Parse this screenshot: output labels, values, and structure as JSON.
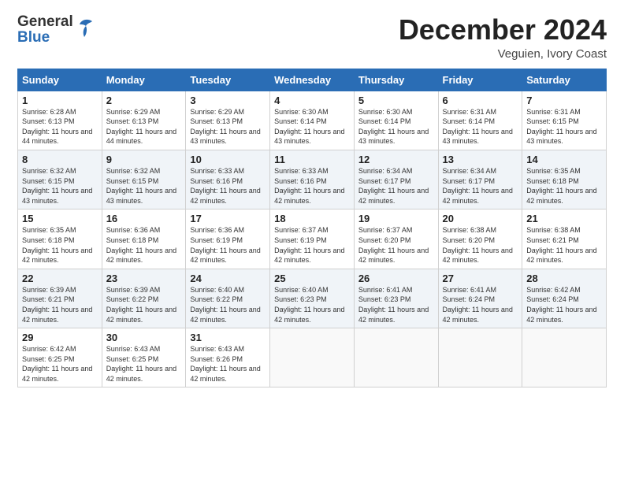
{
  "header": {
    "logo_general": "General",
    "logo_blue": "Blue",
    "month": "December 2024",
    "location": "Veguien, Ivory Coast"
  },
  "days_of_week": [
    "Sunday",
    "Monday",
    "Tuesday",
    "Wednesday",
    "Thursday",
    "Friday",
    "Saturday"
  ],
  "weeks": [
    [
      {
        "day": "1",
        "sunrise": "Sunrise: 6:28 AM",
        "sunset": "Sunset: 6:13 PM",
        "daylight": "Daylight: 11 hours and 44 minutes."
      },
      {
        "day": "2",
        "sunrise": "Sunrise: 6:29 AM",
        "sunset": "Sunset: 6:13 PM",
        "daylight": "Daylight: 11 hours and 44 minutes."
      },
      {
        "day": "3",
        "sunrise": "Sunrise: 6:29 AM",
        "sunset": "Sunset: 6:13 PM",
        "daylight": "Daylight: 11 hours and 43 minutes."
      },
      {
        "day": "4",
        "sunrise": "Sunrise: 6:30 AM",
        "sunset": "Sunset: 6:14 PM",
        "daylight": "Daylight: 11 hours and 43 minutes."
      },
      {
        "day": "5",
        "sunrise": "Sunrise: 6:30 AM",
        "sunset": "Sunset: 6:14 PM",
        "daylight": "Daylight: 11 hours and 43 minutes."
      },
      {
        "day": "6",
        "sunrise": "Sunrise: 6:31 AM",
        "sunset": "Sunset: 6:14 PM",
        "daylight": "Daylight: 11 hours and 43 minutes."
      },
      {
        "day": "7",
        "sunrise": "Sunrise: 6:31 AM",
        "sunset": "Sunset: 6:15 PM",
        "daylight": "Daylight: 11 hours and 43 minutes."
      }
    ],
    [
      {
        "day": "8",
        "sunrise": "Sunrise: 6:32 AM",
        "sunset": "Sunset: 6:15 PM",
        "daylight": "Daylight: 11 hours and 43 minutes."
      },
      {
        "day": "9",
        "sunrise": "Sunrise: 6:32 AM",
        "sunset": "Sunset: 6:15 PM",
        "daylight": "Daylight: 11 hours and 43 minutes."
      },
      {
        "day": "10",
        "sunrise": "Sunrise: 6:33 AM",
        "sunset": "Sunset: 6:16 PM",
        "daylight": "Daylight: 11 hours and 42 minutes."
      },
      {
        "day": "11",
        "sunrise": "Sunrise: 6:33 AM",
        "sunset": "Sunset: 6:16 PM",
        "daylight": "Daylight: 11 hours and 42 minutes."
      },
      {
        "day": "12",
        "sunrise": "Sunrise: 6:34 AM",
        "sunset": "Sunset: 6:17 PM",
        "daylight": "Daylight: 11 hours and 42 minutes."
      },
      {
        "day": "13",
        "sunrise": "Sunrise: 6:34 AM",
        "sunset": "Sunset: 6:17 PM",
        "daylight": "Daylight: 11 hours and 42 minutes."
      },
      {
        "day": "14",
        "sunrise": "Sunrise: 6:35 AM",
        "sunset": "Sunset: 6:18 PM",
        "daylight": "Daylight: 11 hours and 42 minutes."
      }
    ],
    [
      {
        "day": "15",
        "sunrise": "Sunrise: 6:35 AM",
        "sunset": "Sunset: 6:18 PM",
        "daylight": "Daylight: 11 hours and 42 minutes."
      },
      {
        "day": "16",
        "sunrise": "Sunrise: 6:36 AM",
        "sunset": "Sunset: 6:18 PM",
        "daylight": "Daylight: 11 hours and 42 minutes."
      },
      {
        "day": "17",
        "sunrise": "Sunrise: 6:36 AM",
        "sunset": "Sunset: 6:19 PM",
        "daylight": "Daylight: 11 hours and 42 minutes."
      },
      {
        "day": "18",
        "sunrise": "Sunrise: 6:37 AM",
        "sunset": "Sunset: 6:19 PM",
        "daylight": "Daylight: 11 hours and 42 minutes."
      },
      {
        "day": "19",
        "sunrise": "Sunrise: 6:37 AM",
        "sunset": "Sunset: 6:20 PM",
        "daylight": "Daylight: 11 hours and 42 minutes."
      },
      {
        "day": "20",
        "sunrise": "Sunrise: 6:38 AM",
        "sunset": "Sunset: 6:20 PM",
        "daylight": "Daylight: 11 hours and 42 minutes."
      },
      {
        "day": "21",
        "sunrise": "Sunrise: 6:38 AM",
        "sunset": "Sunset: 6:21 PM",
        "daylight": "Daylight: 11 hours and 42 minutes."
      }
    ],
    [
      {
        "day": "22",
        "sunrise": "Sunrise: 6:39 AM",
        "sunset": "Sunset: 6:21 PM",
        "daylight": "Daylight: 11 hours and 42 minutes."
      },
      {
        "day": "23",
        "sunrise": "Sunrise: 6:39 AM",
        "sunset": "Sunset: 6:22 PM",
        "daylight": "Daylight: 11 hours and 42 minutes."
      },
      {
        "day": "24",
        "sunrise": "Sunrise: 6:40 AM",
        "sunset": "Sunset: 6:22 PM",
        "daylight": "Daylight: 11 hours and 42 minutes."
      },
      {
        "day": "25",
        "sunrise": "Sunrise: 6:40 AM",
        "sunset": "Sunset: 6:23 PM",
        "daylight": "Daylight: 11 hours and 42 minutes."
      },
      {
        "day": "26",
        "sunrise": "Sunrise: 6:41 AM",
        "sunset": "Sunset: 6:23 PM",
        "daylight": "Daylight: 11 hours and 42 minutes."
      },
      {
        "day": "27",
        "sunrise": "Sunrise: 6:41 AM",
        "sunset": "Sunset: 6:24 PM",
        "daylight": "Daylight: 11 hours and 42 minutes."
      },
      {
        "day": "28",
        "sunrise": "Sunrise: 6:42 AM",
        "sunset": "Sunset: 6:24 PM",
        "daylight": "Daylight: 11 hours and 42 minutes."
      }
    ],
    [
      {
        "day": "29",
        "sunrise": "Sunrise: 6:42 AM",
        "sunset": "Sunset: 6:25 PM",
        "daylight": "Daylight: 11 hours and 42 minutes."
      },
      {
        "day": "30",
        "sunrise": "Sunrise: 6:43 AM",
        "sunset": "Sunset: 6:25 PM",
        "daylight": "Daylight: 11 hours and 42 minutes."
      },
      {
        "day": "31",
        "sunrise": "Sunrise: 6:43 AM",
        "sunset": "Sunset: 6:26 PM",
        "daylight": "Daylight: 11 hours and 42 minutes."
      },
      null,
      null,
      null,
      null
    ]
  ]
}
